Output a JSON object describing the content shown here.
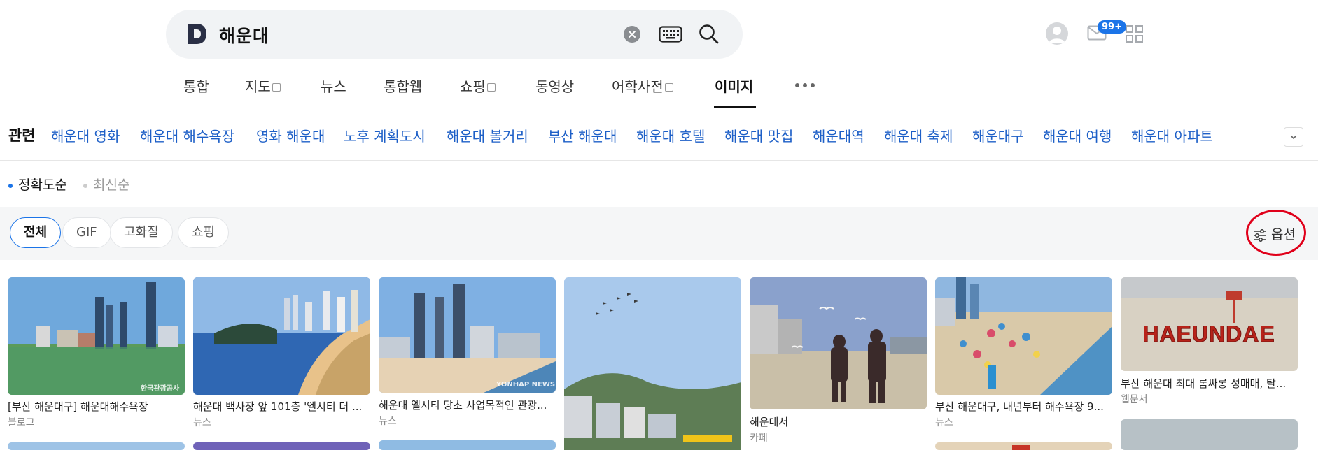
{
  "search": {
    "logo_letter": "D",
    "query": "해운대"
  },
  "header": {
    "mail_badge": "99+"
  },
  "tabs": [
    {
      "label": "통합",
      "external": false,
      "active": false
    },
    {
      "label": "지도",
      "external": true,
      "active": false
    },
    {
      "label": "뉴스",
      "external": false,
      "active": false
    },
    {
      "label": "통합웹",
      "external": false,
      "active": false
    },
    {
      "label": "쇼핑",
      "external": true,
      "active": false
    },
    {
      "label": "동영상",
      "external": false,
      "active": false
    },
    {
      "label": "어학사전",
      "external": true,
      "active": false
    },
    {
      "label": "이미지",
      "external": false,
      "active": true
    }
  ],
  "related": {
    "title": "관련",
    "links": [
      "해운대 영화",
      "해운대 해수욕장",
      "영화 해운대",
      "노후 계획도시",
      "해운대 볼거리",
      "부산 해운대",
      "해운대 호텔",
      "해운대 맛집",
      "해운대역",
      "해운대 축제",
      "해운대구",
      "해운대 여행",
      "해운대 아파트"
    ]
  },
  "sort": {
    "active": "정확도순",
    "inactive": "최신순"
  },
  "filters": {
    "chips": [
      "전체",
      "GIF",
      "고화질",
      "쇼핑"
    ],
    "active_chip": "전체",
    "options_label": "옵션"
  },
  "results": [
    {
      "title": "[부산 해운대구] 해운대해수욕장",
      "source": "블로그",
      "watermark": "한국관광공사"
    },
    {
      "title": "해운대 백사장 앞 101층 '엘시티 더 ...",
      "source": "뉴스",
      "watermark": ""
    },
    {
      "title": "해운대 엘시티 당초 사업목적인 관광...",
      "source": "뉴스",
      "watermark": "YONHAP NEWS"
    },
    {
      "title": "",
      "source": "",
      "watermark": ""
    },
    {
      "title": "해운대서",
      "source": "카페",
      "watermark": ""
    },
    {
      "title": "부산 해운대구, 내년부터 해수욕장 9...",
      "source": "뉴스",
      "watermark": ""
    },
    {
      "title": "부산 해운대 최대 롬싸롱 성매매, 탈...",
      "source": "웹문서",
      "watermark": "",
      "sign_text": "HAEUNDAE"
    }
  ],
  "colors": {
    "accent": "#1b74e8",
    "link": "#1d5fc7",
    "highlight_circle": "#e0001a"
  }
}
